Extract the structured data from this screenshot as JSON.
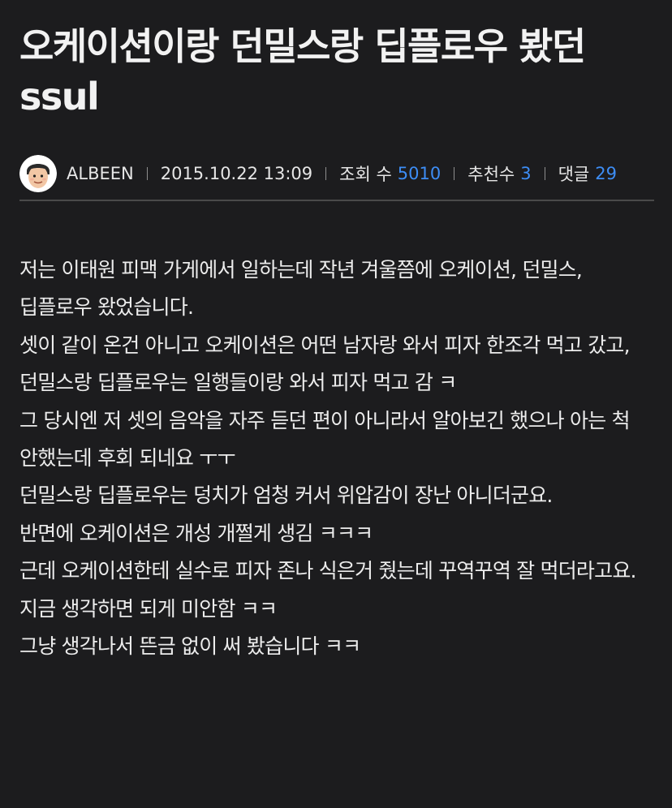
{
  "post": {
    "title": "오케이션이랑 던밀스랑 딥플로우 봤던 ssul",
    "author": "ALBEEN",
    "date": "2015.10.22 13:09",
    "views_label": "조회 수",
    "views": "5010",
    "recommend_label": "추천수",
    "recommend": "3",
    "comments_label": "댓글",
    "comments": "29",
    "avatar_icon": "user-avatar-icon",
    "accent_color": "#3d8df5",
    "body_lines": [
      "저는 이태원 피맥 가게에서 일하는데 작년 겨울쯤에 오케이션, 던밀스, 딥플로우 왔었습니다.",
      "셋이 같이 온건 아니고 오케이션은 어떤 남자랑 와서 피자 한조각 먹고 갔고, 던밀스랑 딥플로우는 일행들이랑 와서 피자 먹고 감 ㅋ",
      "그 당시엔 저 셋의 음악을 자주 듣던 편이 아니라서 알아보긴 했으나 아는 척 안했는데 후회 되네요 ㅜㅜ",
      "던밀스랑 딥플로우는 덩치가 엄청 커서 위압감이 장난 아니더군요.",
      "반면에 오케이션은 개성 개쩔게 생김 ㅋㅋㅋ",
      "근데 오케이션한테 실수로 피자 존나 식은거 줬는데 꾸역꾸역 잘 먹더라고요. 지금 생각하면 되게 미안함 ㅋㅋ",
      "그냥 생각나서 뜬금 없이 써 봤습니다 ㅋㅋ"
    ]
  }
}
